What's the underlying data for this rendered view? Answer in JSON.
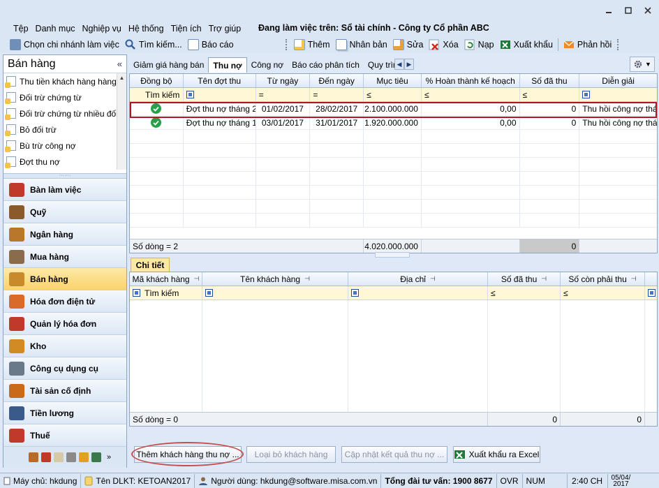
{
  "menu": [
    "Tệp",
    "Danh mục",
    "Nghiệp vụ",
    "Hệ thống",
    "Tiện ích",
    "Trợ giúp"
  ],
  "working_on": "Đang làm việc trên: Sổ tài chính - Công ty Cổ phần ABC",
  "toolbar": {
    "branch": "Chọn chi nhánh làm việc",
    "search": "Tìm kiếm...",
    "report": "Báo cáo",
    "add": "Thêm",
    "copy": "Nhân bản",
    "edit": "Sửa",
    "delete": "Xóa",
    "load": "Nạp",
    "export": "Xuất khẩu",
    "feedback": "Phản hồi"
  },
  "left_panel": {
    "title": "Bán hàng",
    "items": [
      "Thu tiền khách hàng hàng",
      "Đối trừ chứng từ",
      "Đối trừ chứng từ nhiều đối tư...",
      "Bỏ đối trừ",
      "Bù trừ công nợ",
      "Đợt thu nợ"
    ],
    "nav": [
      {
        "label": "Bàn làm việc",
        "color": "#c0392b"
      },
      {
        "label": "Quỹ",
        "color": "#8a5a2b"
      },
      {
        "label": "Ngân hàng",
        "color": "#b9772a"
      },
      {
        "label": "Mua hàng",
        "color": "#8a6c4c"
      },
      {
        "label": "Bán hàng",
        "color": "#c98a2a"
      },
      {
        "label": "Hóa đơn điện tử",
        "color": "#d96a2a"
      },
      {
        "label": "Quản lý hóa đơn",
        "color": "#c0392b"
      },
      {
        "label": "Kho",
        "color": "#d18a24"
      },
      {
        "label": "Công cụ dụng cụ",
        "color": "#6b7a8a"
      },
      {
        "label": "Tài sản cố định",
        "color": "#c86a1a"
      },
      {
        "label": "Tiền lương",
        "color": "#3a5a8a"
      },
      {
        "label": "Thuế",
        "color": "#c0392b"
      }
    ]
  },
  "tabs": [
    "Giảm giá hàng bán",
    "Thu nợ",
    "Công nợ",
    "Báo cáo phân tích",
    "Quy trìn"
  ],
  "top_grid": {
    "headers": [
      "Đồng bộ",
      "Tên đợt thu",
      "Từ ngày",
      "Đến ngày",
      "Mục tiêu",
      "% Hoàn thành kế hoạch",
      "Số đã thu",
      "Diễn giải"
    ],
    "filter_label": "Tìm kiếm",
    "filter_ops": [
      "=",
      "=",
      "≤",
      "≤",
      "≤"
    ],
    "rows": [
      {
        "name": "Đợt thu nợ tháng 2",
        "from": "01/02/2017",
        "to": "28/02/2017",
        "target": "2.100.000.000",
        "pct": "0,00",
        "collected": "0",
        "desc": "Thu hồi công nợ thá"
      },
      {
        "name": "Đợt thu nợ tháng 1",
        "from": "03/01/2017",
        "to": "31/01/2017",
        "target": "1.920.000.000",
        "pct": "0,00",
        "collected": "0",
        "desc": "Thu hồi công nợ thá"
      }
    ],
    "footer_count": "Số dòng = 2",
    "footer_target": "4.020.000.000",
    "footer_collected": "0"
  },
  "detail": {
    "tab": "Chi tiết",
    "headers": [
      "Mã khách hàng",
      "Tên khách hàng",
      "Địa chỉ",
      "Số đã thu",
      "Số còn phải thu"
    ],
    "filter_label": "Tìm kiếm",
    "filter_ops": [
      "≤",
      "≤"
    ],
    "footer_count": "Số dòng = 0",
    "footer_collected": "0",
    "footer_remaining": "0"
  },
  "buttons": {
    "add_customer": "Thêm khách hàng thu nợ ...",
    "remove_customer": "Loại bỏ khách hàng",
    "update_result": "Cập nhật kết quả thu nợ ...",
    "export_excel": "Xuất khẩu ra Excel"
  },
  "status": {
    "server": "Máy chủ: hkdung",
    "db": "Tên DLKT: KETOAN2017",
    "user": "Người dùng: hkdung@software.misa.com.vn",
    "hotline": "Tổng đài tư vấn: 1900 8677",
    "ovr": "OVR",
    "num": "NUM",
    "time": "2:40 CH",
    "date_line1": "05/04/",
    "date_line2": "2017"
  }
}
